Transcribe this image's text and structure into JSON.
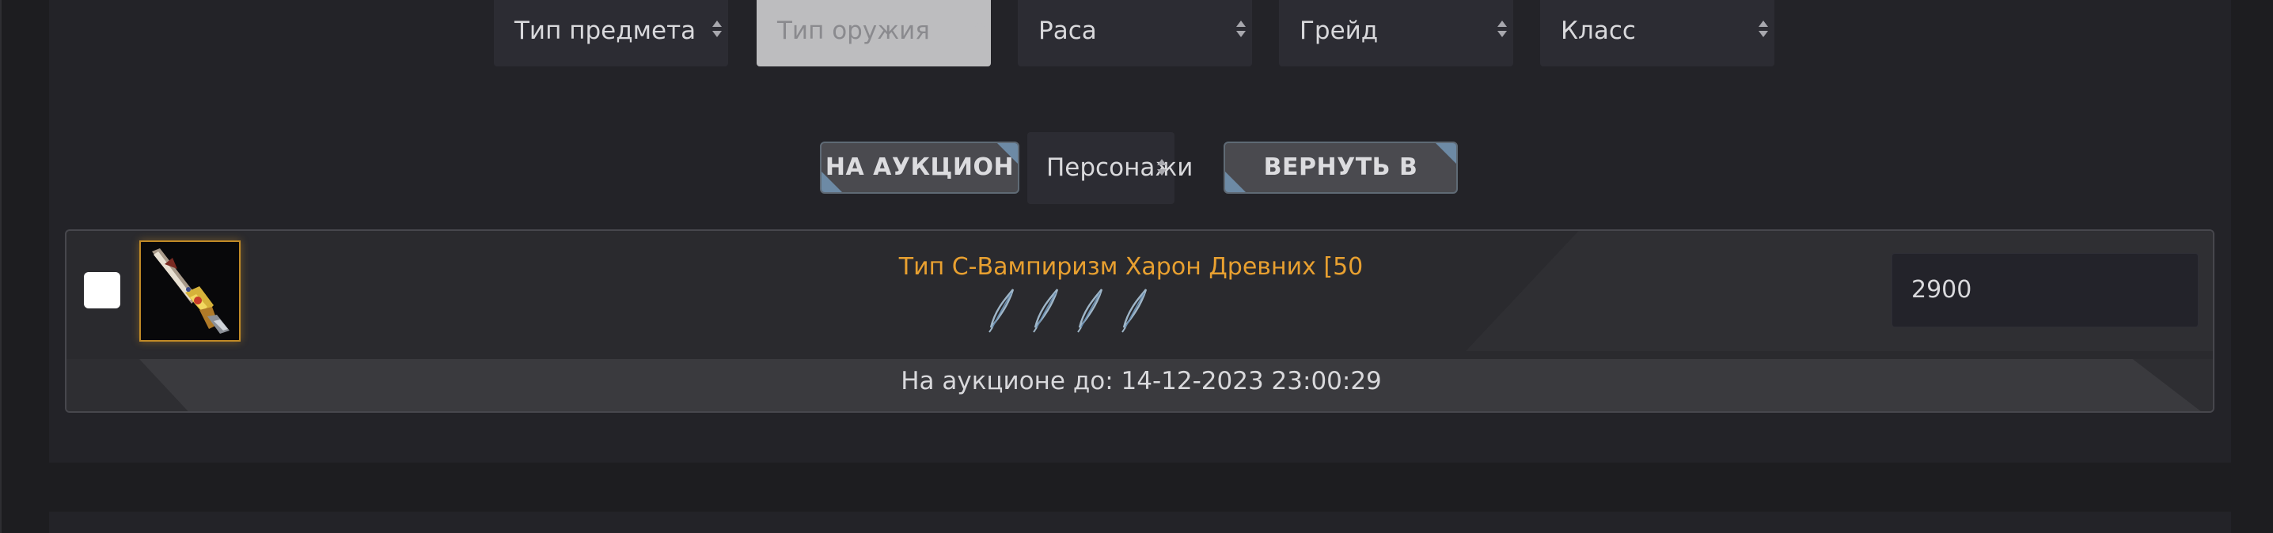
{
  "filters": {
    "item_type": "Тип предмета",
    "weapon_type": "Тип оружия",
    "race": "Раса",
    "grade": "Грейд",
    "class": "Класс"
  },
  "actions": {
    "to_auction_label": "НА АУКЦИОН",
    "characters_select": "Персонажи",
    "return_to_game_label": "ВЕРНУТЬ В ИГРУ"
  },
  "item": {
    "name": "Тип C-Вампиризм Харон Древних [50",
    "name_color": "#e8a030",
    "price": "2900",
    "auction_until": "На аукционе до: 14-12-2023 23:00:29",
    "icon": "weapon-item-icon",
    "feather_icons": [
      "feather-icon",
      "feather-icon",
      "feather-icon",
      "feather-icon"
    ]
  },
  "colors": {
    "background": "#1d1d20",
    "panel": "#232328",
    "button_accent": "#6d8aa5"
  }
}
